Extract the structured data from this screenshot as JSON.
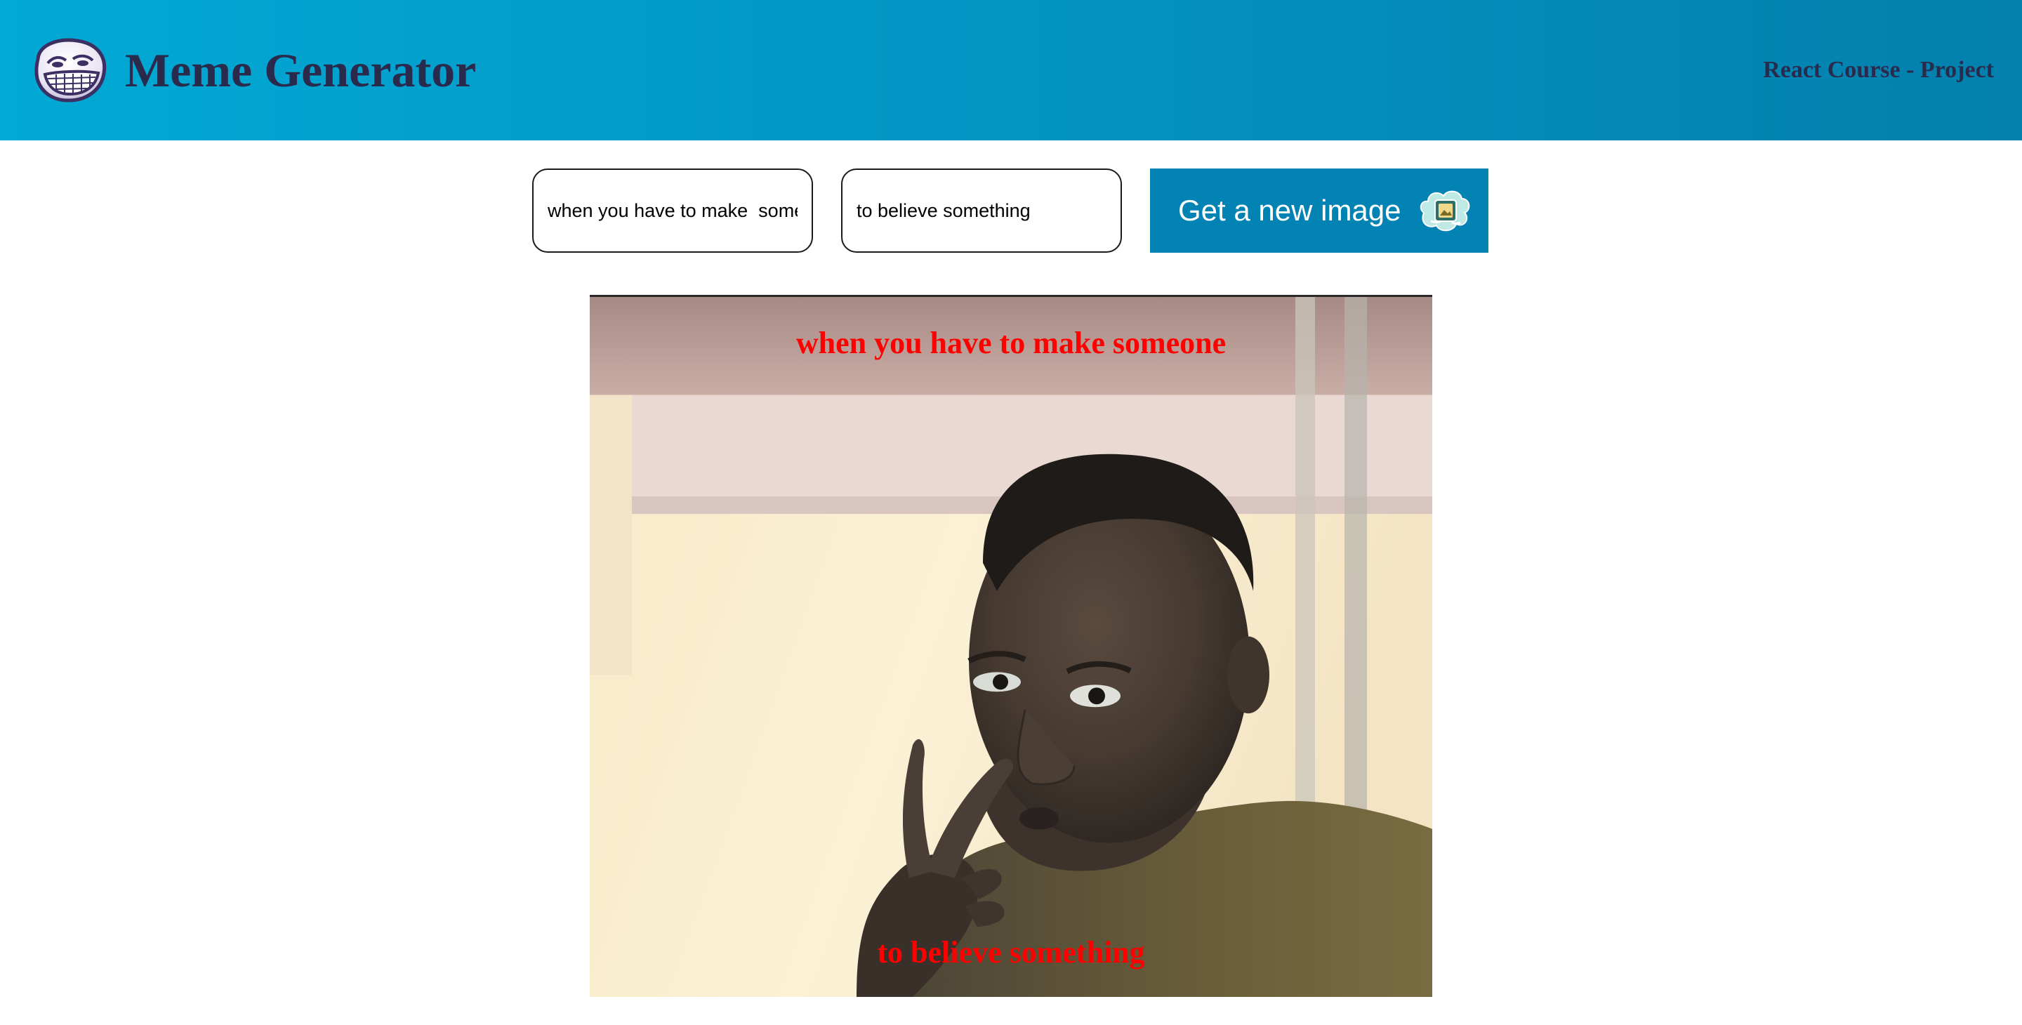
{
  "header": {
    "logo_icon": "troll-face-icon",
    "title": "Meme Generator",
    "subtitle": "React Course - Project",
    "title_color": "#2a2b4c"
  },
  "form": {
    "top_text_value": "when you have to make  someone",
    "bottom_text_value": "to believe something",
    "button_label": "Get a new image",
    "button_icon": "image-icon",
    "button_color": "#0382b4"
  },
  "meme": {
    "image": "photo of a man with a hand gesture near his face",
    "top_text": "when you have to make someone",
    "bottom_text": "to believe something",
    "text_color": "#ff0000"
  },
  "colors": {
    "header_start": "#01a9d5",
    "header_end": "#0380ad"
  }
}
